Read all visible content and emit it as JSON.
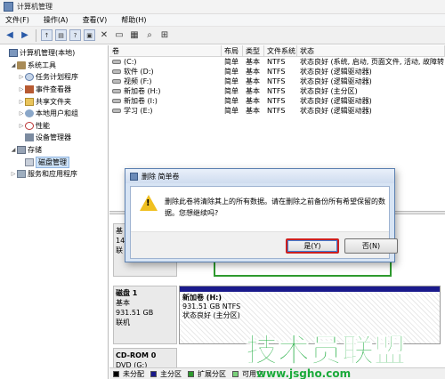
{
  "window": {
    "title": "计算机管理"
  },
  "menu": [
    "文件(F)",
    "操作(A)",
    "查看(V)",
    "帮助(H)"
  ],
  "toolbar": {
    "icons": [
      "back-arrow-icon",
      "forward-arrow-icon",
      "up-folder-icon",
      "show-hide-tree-icon",
      "help-icon",
      "properties-icon",
      "delete-icon",
      "open-icon",
      "export-icon",
      "search-icon",
      "zoom-icon"
    ]
  },
  "tree": [
    {
      "label": "计算机管理(本地)",
      "indent": 0,
      "toggle": "",
      "icon": "computer-icon",
      "ic": "ic-comp"
    },
    {
      "label": "系统工具",
      "indent": 1,
      "toggle": "◢",
      "icon": "tools-icon",
      "ic": "ic-tools"
    },
    {
      "label": "任务计划程序",
      "indent": 2,
      "toggle": "▷",
      "icon": "clock-icon",
      "ic": "ic-clock"
    },
    {
      "label": "事件查看器",
      "indent": 2,
      "toggle": "▷",
      "icon": "event-log-icon",
      "ic": "ic-log"
    },
    {
      "label": "共享文件夹",
      "indent": 2,
      "toggle": "▷",
      "icon": "shared-folder-icon",
      "ic": "ic-folder"
    },
    {
      "label": "本地用户和组",
      "indent": 2,
      "toggle": "▷",
      "icon": "users-icon",
      "ic": "ic-users"
    },
    {
      "label": "性能",
      "indent": 2,
      "toggle": "▷",
      "icon": "performance-icon",
      "ic": "ic-perf"
    },
    {
      "label": "设备管理器",
      "indent": 2,
      "toggle": "",
      "icon": "device-manager-icon",
      "ic": "ic-dev"
    },
    {
      "label": "存储",
      "indent": 1,
      "toggle": "◢",
      "icon": "storage-icon",
      "ic": "ic-store"
    },
    {
      "label": "磁盘管理",
      "indent": 2,
      "toggle": "",
      "icon": "disk-management-icon",
      "ic": "ic-disk",
      "selected": true
    },
    {
      "label": "服务和应用程序",
      "indent": 1,
      "toggle": "▷",
      "icon": "services-icon",
      "ic": "ic-svc"
    }
  ],
  "volumes": {
    "headers": [
      "卷",
      "布局",
      "类型",
      "文件系统",
      "状态"
    ],
    "rows": [
      {
        "vol": "(C:)",
        "layout": "简单",
        "type": "基本",
        "fs": "NTFS",
        "status": "状态良好 (系统, 启动, 页面文件, 活动, 故障转"
      },
      {
        "vol": "软件 (D:)",
        "layout": "简单",
        "type": "基本",
        "fs": "NTFS",
        "status": "状态良好 (逻辑驱动器)"
      },
      {
        "vol": "视频 (F:)",
        "layout": "简单",
        "type": "基本",
        "fs": "NTFS",
        "status": "状态良好 (逻辑驱动器)"
      },
      {
        "vol": "新加卷 (H:)",
        "layout": "简单",
        "type": "基本",
        "fs": "NTFS",
        "status": "状态良好 (主分区)"
      },
      {
        "vol": "新加卷 (I:)",
        "layout": "简单",
        "type": "基本",
        "fs": "NTFS",
        "status": "状态良好 (逻辑驱动器)"
      },
      {
        "vol": "学习 (E:)",
        "layout": "简单",
        "type": "基本",
        "fs": "NTFS",
        "status": "状态良好 (逻辑驱动器)"
      }
    ]
  },
  "disk0": {
    "l1": "基",
    "l2": "14",
    "l3": "联"
  },
  "disk1": {
    "name": "磁盘 1",
    "type": "基本",
    "size": "931.51 GB",
    "state": "联机",
    "partition": {
      "name": "新加卷 (H:)",
      "size": "931.51 GB NTFS",
      "status": "状态良好 (主分区)"
    }
  },
  "cdrom": {
    "name": "CD-ROM 0",
    "drive": "DVD (G:)"
  },
  "legend": [
    {
      "label": "未分配",
      "color": "#000000"
    },
    {
      "label": "主分区",
      "color": "#1a1a8c"
    },
    {
      "label": "扩展分区",
      "color": "#2e9a2e"
    },
    {
      "label": "可用空",
      "color": "#7ad07a"
    }
  ],
  "dialog": {
    "title": "删除 简单卷",
    "message": "删除此卷将清除其上的所有数据。请在删除之前备份所有希望保留的数据。您想继续吗?",
    "yes": "是(Y)",
    "no": "否(N)"
  },
  "watermark": {
    "text": "技术员联盟",
    "url": "www.jsgho.com"
  }
}
